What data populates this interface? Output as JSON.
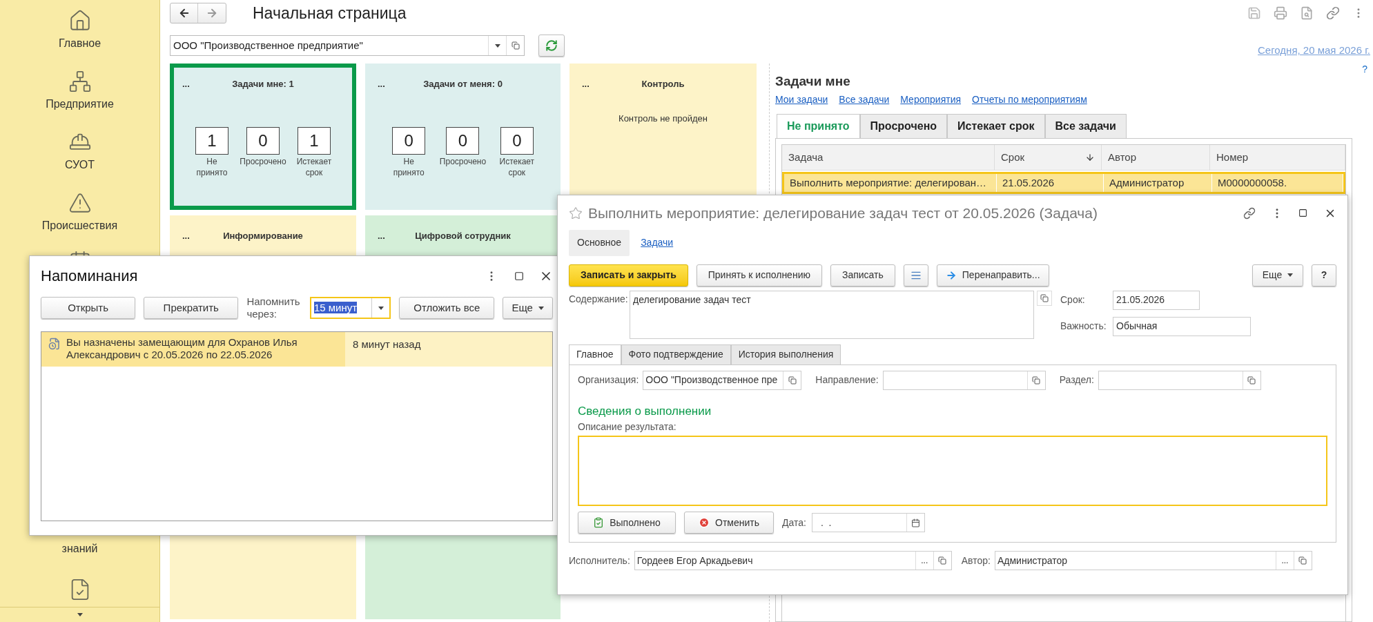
{
  "sidebar": {
    "items": [
      {
        "label": "Главное"
      },
      {
        "label": "Предприятие"
      },
      {
        "label": "СУОТ"
      },
      {
        "label": "Происшествия"
      }
    ],
    "lower_label": "знаний"
  },
  "header": {
    "title": "Начальная страница"
  },
  "organization": {
    "value": "ООО \"Производственное предприятие\""
  },
  "tiles": [
    {
      "kind": "counters",
      "menu": "...",
      "title": "Задачи мне: 1",
      "selected": true,
      "color": "#ddefee",
      "counters": [
        {
          "value": "1",
          "label": "Не принято"
        },
        {
          "value": "0",
          "label": "Просрочено"
        },
        {
          "value": "1",
          "label": "Истекает срок"
        }
      ]
    },
    {
      "kind": "counters",
      "menu": "...",
      "title": "Задачи от меня: 0",
      "selected": false,
      "color": "#ddefee",
      "counters": [
        {
          "value": "0",
          "label": "Не принято"
        },
        {
          "value": "0",
          "label": "Просрочено"
        },
        {
          "value": "0",
          "label": "Истекает срок"
        }
      ]
    },
    {
      "kind": "message",
      "menu": "...",
      "title": "Контроль",
      "selected": false,
      "color": "#fdf3c8",
      "message": "Контроль не пройден"
    },
    {
      "kind": "plain",
      "menu": "...",
      "title": "Информирование",
      "selected": false,
      "color": "#fdf3c8"
    },
    {
      "kind": "plain",
      "menu": "...",
      "title": "Цифровой сотрудник",
      "selected": false,
      "color": "#d4efd8"
    }
  ],
  "date_link": "Сегодня, 20 мая 2026 г.",
  "help": "?",
  "tasks_panel": {
    "title": "Задачи мне",
    "links": [
      "Мои задачи",
      "Все задачи",
      "Мероприятия",
      "Отчеты по мероприятиям"
    ],
    "tabs": [
      {
        "label": "Не принято",
        "selected": true
      },
      {
        "label": "Просрочено",
        "selected": false
      },
      {
        "label": "Истекает срок",
        "selected": false
      },
      {
        "label": "Все задачи",
        "selected": false
      }
    ],
    "table": {
      "columns": [
        {
          "label": "Задача",
          "sorted": false
        },
        {
          "label": "Срок",
          "sorted": true
        },
        {
          "label": "Автор",
          "sorted": false
        },
        {
          "label": "Номер",
          "sorted": false
        }
      ],
      "rows": [
        {
          "selected": true,
          "cells": [
            "Выполнить мероприятие: делегирован…",
            "21.05.2026",
            "Администратор",
            "M0000000058."
          ]
        }
      ]
    }
  },
  "reminders": {
    "title": "Напоминания",
    "buttons": [
      "Открыть",
      "Прекратить"
    ],
    "remind_label": "Напомнить через:",
    "remind_value": "15 минут",
    "postpone": "Отложить все",
    "more": "Еще",
    "items": [
      {
        "text": "Вы назначены замещающим для Охранов Илья Александрович с 20.05.2026 по 22.05.2026",
        "time": "8 минут назад",
        "selected": true
      }
    ]
  },
  "task": {
    "title": "Выполнить мероприятие: делегирование задач тест от 20.05.2026 (Задача)",
    "sections": [
      {
        "label": "Основное",
        "selected": true
      },
      {
        "label": "Задачи",
        "selected": false
      }
    ],
    "buttons": [
      {
        "kind": "primary",
        "label": "Записать и закрыть"
      },
      {
        "kind": "default",
        "label": "Принять к исполнению"
      },
      {
        "kind": "default",
        "label": "Записать"
      },
      {
        "kind": "list"
      },
      {
        "kind": "forward",
        "label": "Перенаправить..."
      }
    ],
    "more": "Еще",
    "help": "?",
    "content": {
      "label": "Содержание:",
      "value": "делегирование задач тест"
    },
    "due": {
      "label": "Срок:",
      "value": "21.05.2026"
    },
    "importance": {
      "label": "Важность:",
      "value": "Обычная"
    },
    "tabs": [
      {
        "label": "Главное",
        "selected": true
      },
      {
        "label": "Фото подтверждение",
        "selected": false
      },
      {
        "label": "История выполнения",
        "selected": false
      }
    ],
    "fields": [
      {
        "label": "Организация:",
        "value": "ООО \"Производственное пре"
      },
      {
        "label": "Направление:"
      },
      {
        "label": "Раздел:"
      }
    ],
    "completion": {
      "heading": "Сведения о выполнении",
      "result_label": "Описание результата:",
      "done": "Выполнено",
      "cancel": "Отменить",
      "date_label": "Дата:",
      "date_value": ".  ."
    },
    "people": [
      {
        "label": "Исполнитель:",
        "value": "Гордеев Егор Аркадьевич",
        "choose": "..."
      },
      {
        "label": "Автор:",
        "value": "Администратор",
        "choose": "..."
      }
    ]
  }
}
